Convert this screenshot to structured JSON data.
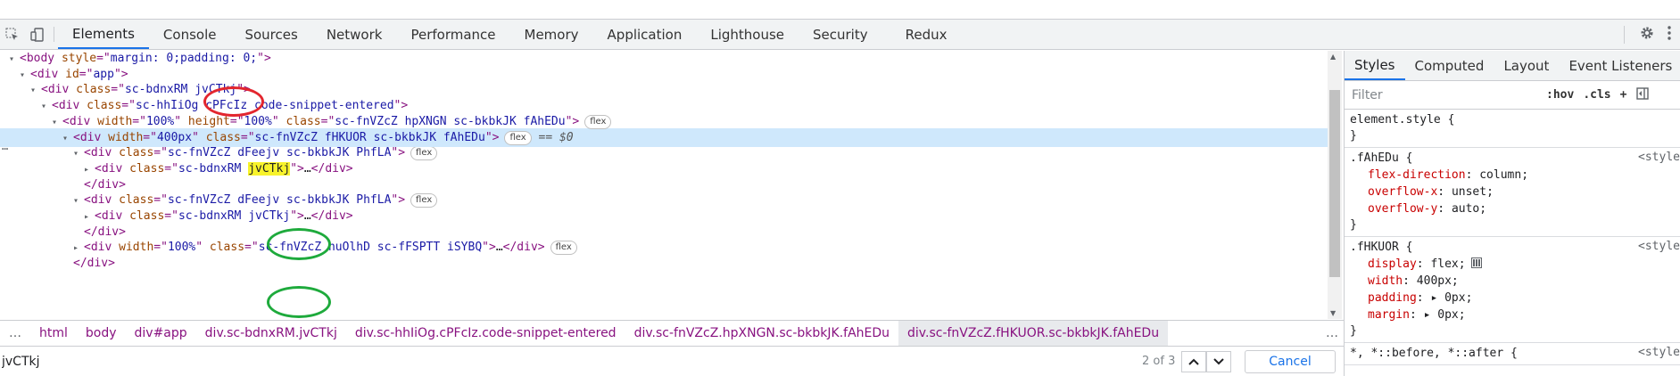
{
  "tabs": [
    "Elements",
    "Console",
    "Sources",
    "Network",
    "Performance",
    "Memory",
    "Application",
    "Lighthouse",
    "Security",
    "Redux"
  ],
  "active_tab": "Elements",
  "dom_tree": [
    {
      "indent": 0,
      "tri": "▾",
      "parts": [
        [
          "tag",
          "<body "
        ],
        [
          "attr",
          "style"
        ],
        [
          "tag",
          "=\""
        ],
        [
          "val",
          "margin: 0;padding: 0;"
        ],
        [
          "tag",
          "\">"
        ]
      ]
    },
    {
      "indent": 1,
      "tri": "▾",
      "parts": [
        [
          "tag",
          "<div "
        ],
        [
          "attr",
          "id"
        ],
        [
          "tag",
          "=\""
        ],
        [
          "val",
          "app"
        ],
        [
          "tag",
          "\">"
        ]
      ]
    },
    {
      "indent": 2,
      "tri": "▾",
      "parts": [
        [
          "tag",
          "<div "
        ],
        [
          "attr",
          "class"
        ],
        [
          "tag",
          "=\""
        ],
        [
          "val",
          "sc-bdnxRM "
        ],
        [
          "val",
          "jvCTkj"
        ],
        [
          "tag",
          "\">"
        ]
      ]
    },
    {
      "indent": 3,
      "tri": "▾",
      "parts": [
        [
          "tag",
          "<div "
        ],
        [
          "attr",
          "class"
        ],
        [
          "tag",
          "=\""
        ],
        [
          "val",
          "sc-hhIiOg cPFcIz code-snippet-entered"
        ],
        [
          "tag",
          "\">"
        ]
      ]
    },
    {
      "indent": 4,
      "tri": "▾",
      "parts": [
        [
          "tag",
          "<div "
        ],
        [
          "attr",
          "width"
        ],
        [
          "tag",
          "=\""
        ],
        [
          "val",
          "100%"
        ],
        [
          "tag",
          "\" "
        ],
        [
          "attr",
          "height"
        ],
        [
          "tag",
          "=\""
        ],
        [
          "val",
          "100%"
        ],
        [
          "tag",
          "\" "
        ],
        [
          "attr",
          "class"
        ],
        [
          "tag",
          "=\""
        ],
        [
          "val",
          "sc-fnVZcZ hpXNGN sc-bkbkJK fAhEDu"
        ],
        [
          "tag",
          "\">"
        ]
      ],
      "badge": "flex"
    },
    {
      "indent": 5,
      "tri": "▾",
      "selected": true,
      "parts": [
        [
          "tag",
          "<div "
        ],
        [
          "attr",
          "width"
        ],
        [
          "tag",
          "=\""
        ],
        [
          "val",
          "400px"
        ],
        [
          "tag",
          "\" "
        ],
        [
          "attr",
          "class"
        ],
        [
          "tag",
          "=\""
        ],
        [
          "val",
          "sc-fnVZcZ fHKUOR sc-bkbkJK fAhEDu"
        ],
        [
          "tag",
          "\">"
        ]
      ],
      "badge": "flex",
      "suffix": "== $0"
    },
    {
      "indent": 6,
      "tri": "▾",
      "parts": [
        [
          "tag",
          "<div "
        ],
        [
          "attr",
          "class"
        ],
        [
          "tag",
          "=\""
        ],
        [
          "val",
          "sc-fnVZcZ dFeejv sc-bkbkJK PhfLA"
        ],
        [
          "tag",
          "\">"
        ]
      ],
      "badge": "flex"
    },
    {
      "indent": 7,
      "tri": "▸",
      "parts": [
        [
          "tag",
          "<div "
        ],
        [
          "attr",
          "class"
        ],
        [
          "tag",
          "=\""
        ],
        [
          "val",
          "sc-bdnxRM "
        ],
        [
          "hl",
          "jvCTkj"
        ],
        [
          "tag",
          "\">"
        ],
        [
          "txt",
          "…"
        ],
        [
          "tag",
          "</div>"
        ]
      ]
    },
    {
      "indent": 6,
      "tri": "",
      "parts": [
        [
          "tag",
          "</div>"
        ]
      ]
    },
    {
      "indent": 6,
      "tri": "▾",
      "parts": [
        [
          "tag",
          "<div "
        ],
        [
          "attr",
          "class"
        ],
        [
          "tag",
          "=\""
        ],
        [
          "val",
          "sc-fnVZcZ dFeejv sc-bkbkJK PhfLA"
        ],
        [
          "tag",
          "\">"
        ]
      ],
      "badge": "flex"
    },
    {
      "indent": 7,
      "tri": "▸",
      "parts": [
        [
          "tag",
          "<div "
        ],
        [
          "attr",
          "class"
        ],
        [
          "tag",
          "=\""
        ],
        [
          "val",
          "sc-bdnxRM "
        ],
        [
          "val",
          "jvCTkj"
        ],
        [
          "tag",
          "\">"
        ],
        [
          "txt",
          "…"
        ],
        [
          "tag",
          "</div>"
        ]
      ]
    },
    {
      "indent": 6,
      "tri": "",
      "parts": [
        [
          "tag",
          "</div>"
        ]
      ]
    },
    {
      "indent": 6,
      "tri": "▸",
      "parts": [
        [
          "tag",
          "<div "
        ],
        [
          "attr",
          "width"
        ],
        [
          "tag",
          "=\""
        ],
        [
          "val",
          "100%"
        ],
        [
          "tag",
          "\" "
        ],
        [
          "attr",
          "class"
        ],
        [
          "tag",
          "=\""
        ],
        [
          "val",
          "sc-fnVZcZ huOlhD sc-fFSPTT iSYBQ"
        ],
        [
          "tag",
          "\">"
        ],
        [
          "txt",
          "…"
        ],
        [
          "tag",
          "</div>"
        ]
      ],
      "badge": "flex"
    },
    {
      "indent": 5,
      "tri": "",
      "parts": [
        [
          "tag",
          "</div>"
        ]
      ]
    }
  ],
  "breadcrumb": [
    "html",
    "body",
    "div#app",
    "div.sc-bdnxRM.jvCTkj",
    "div.sc-hhIiOg.cPFcIz.code-snippet-entered",
    "div.sc-fnVZcZ.hpXNGN.sc-bkbkJK.fAhEDu",
    "div.sc-fnVZcZ.fHKUOR.sc-bkbkJK.fAhEDu"
  ],
  "search": {
    "value": "jvCTkj",
    "match_count": "2 of 3",
    "cancel_label": "Cancel"
  },
  "styles_tabs": [
    "Styles",
    "Computed",
    "Layout",
    "Event Listeners"
  ],
  "styles_active": "Styles",
  "filter_placeholder": "Filter",
  "filter_tools": [
    ":hov",
    ".cls",
    "+"
  ],
  "style_rules": [
    {
      "selector": "element.style {",
      "origin": "",
      "decls": [],
      "close": "}"
    },
    {
      "selector": ".fAhEDu {",
      "origin": "<style",
      "decls": [
        [
          "flex-direction",
          "column;"
        ],
        [
          "overflow-x",
          "unset;"
        ],
        [
          "overflow-y",
          "auto;"
        ]
      ],
      "close": "}"
    },
    {
      "selector": ".fHKUOR {",
      "origin": "<style",
      "decls": [
        [
          "display",
          "flex;"
        ],
        [
          "width",
          "400px;"
        ],
        [
          "padding",
          "▸ 0px;"
        ],
        [
          "margin",
          "▸ 0px;"
        ]
      ],
      "close": "}"
    },
    {
      "selector": "*, *::before, *::after {",
      "origin": "<style",
      "decls": [],
      "close": ""
    }
  ]
}
